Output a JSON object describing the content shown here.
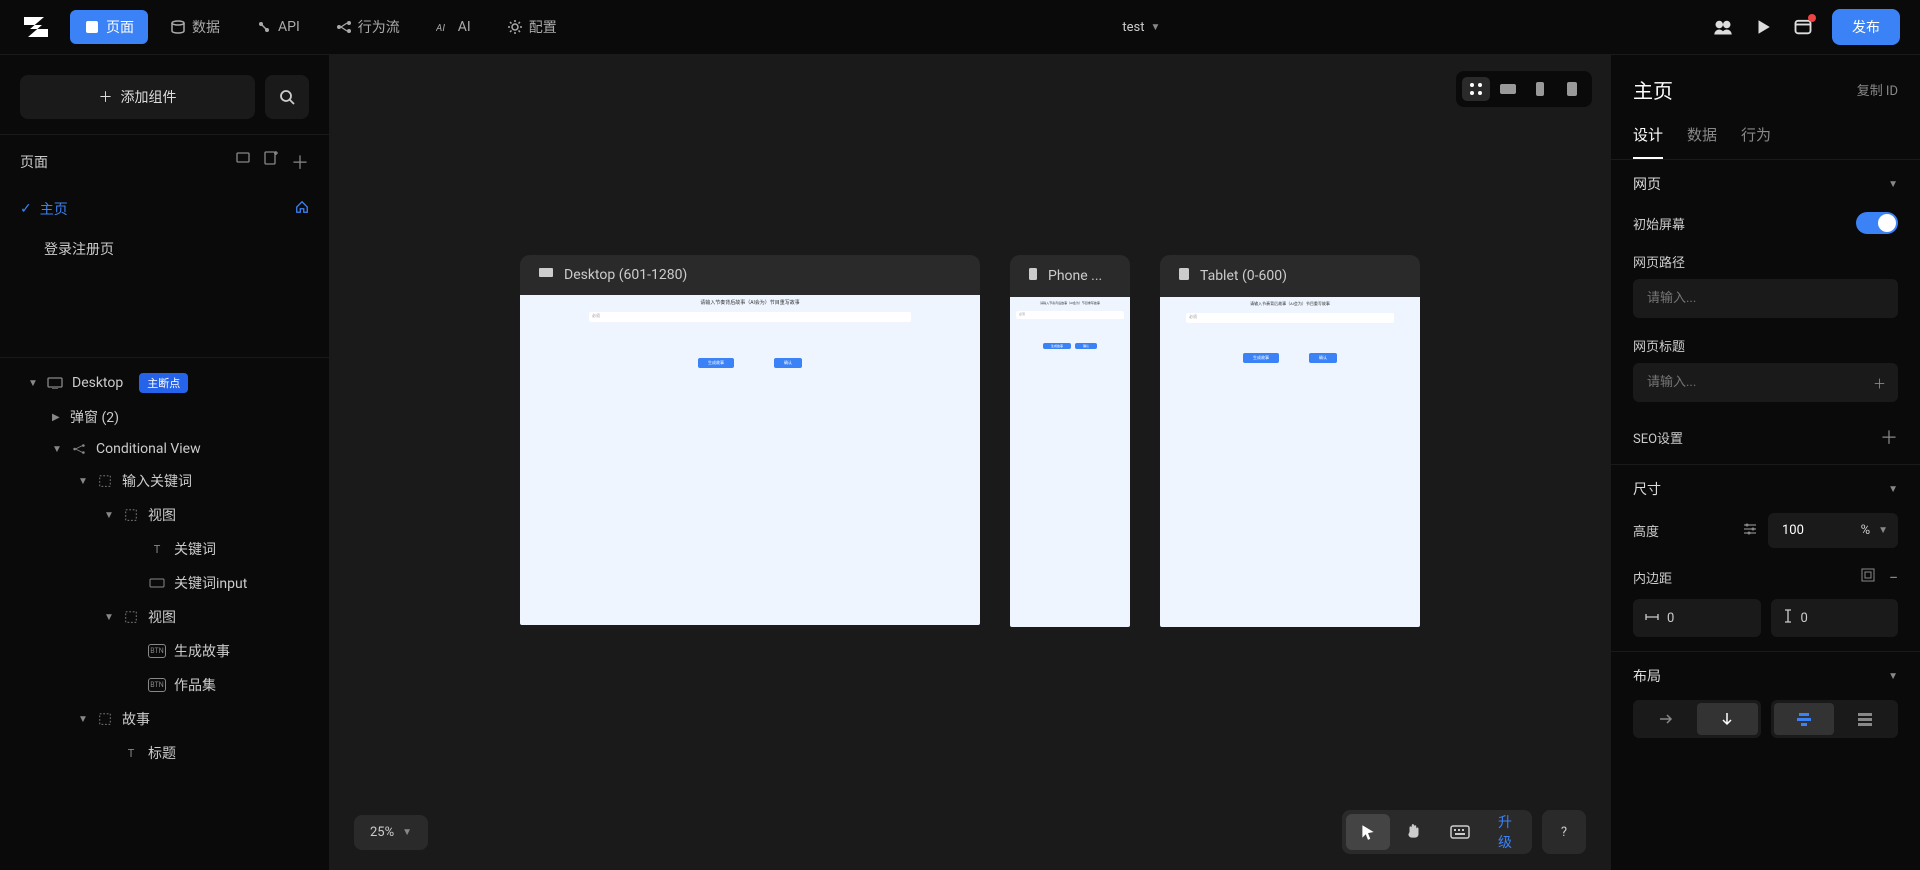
{
  "topbar": {
    "nav": {
      "pages": "页面",
      "data": "数据",
      "api": "API",
      "flow": "行为流",
      "ai": "AI",
      "config": "配置"
    },
    "project_name": "test",
    "publish": "发布"
  },
  "left": {
    "add_widget": "添加组件",
    "pages_header": "页面",
    "page_home": "主页",
    "page_login": "登录注册页",
    "tree": {
      "desktop": "Desktop",
      "breakpoint_badge": "主断点",
      "popup": "弹窗 (2)",
      "conditional": "Conditional View",
      "input_keyword": "输入关键词",
      "view1": "视图",
      "keyword": "关键词",
      "keyword_input": "关键词input",
      "view2": "视图",
      "gen_story": "生成故事",
      "works": "作品集",
      "story": "故事",
      "title": "标题"
    }
  },
  "canvas": {
    "desktop_label": "Desktop (601-1280)",
    "phone_label": "Phone ...",
    "tablet_label": "Tablet (0-600)",
    "mini_title": "请输入节奏背后故事（AI会为）节目重写故事",
    "mini_placeholder": "必须",
    "mini_btn1": "生成故事",
    "mini_btn2": "确认",
    "zoom": "25%",
    "upgrade": "升级"
  },
  "right": {
    "title": "主页",
    "copy_id": "复制 ID",
    "tabs": {
      "design": "设计",
      "data": "数据",
      "behavior": "行为"
    },
    "web_section": "网页",
    "initial_screen": "初始屏幕",
    "path_label": "网页路径",
    "path_placeholder": "请输入...",
    "title_label": "网页标题",
    "title_placeholder": "请输入...",
    "seo": "SEO设置",
    "size_section": "尺寸",
    "height_label": "高度",
    "height_value": "100",
    "height_unit": "%",
    "padding_label": "内边距",
    "pad_h": "0",
    "pad_v": "0",
    "layout_section": "布局"
  }
}
